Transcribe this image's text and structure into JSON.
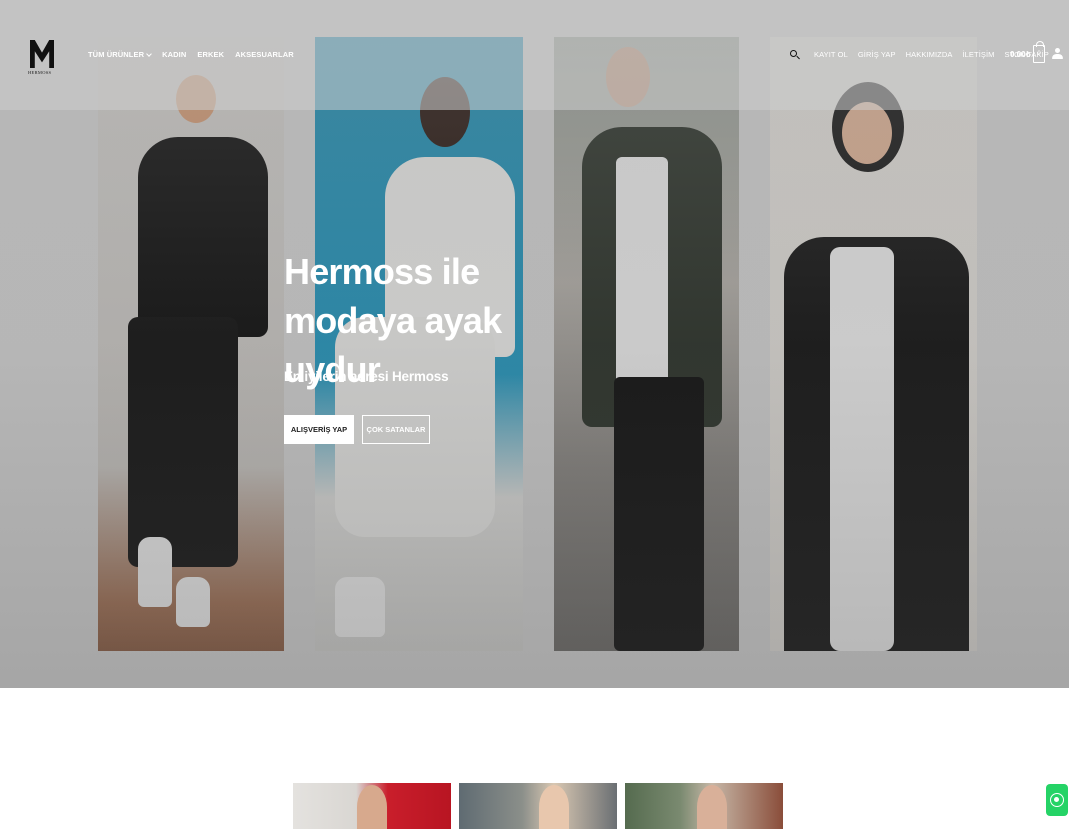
{
  "logo": {
    "text": "HERMOSS"
  },
  "nav": {
    "left": [
      {
        "label": "TÜM ÜRÜNLER",
        "has_dropdown": true
      },
      {
        "label": "KADIN"
      },
      {
        "label": "ERKEK"
      },
      {
        "label": "AKSESUARLAR"
      }
    ],
    "right": [
      {
        "label": "KAYIT OL"
      },
      {
        "label": "GİRİŞ YAP"
      },
      {
        "label": "HAKKIMIZDA"
      },
      {
        "label": "İLETİŞİM"
      },
      {
        "label": "STOK TAKİP"
      }
    ]
  },
  "cart": {
    "total": "0.00₺",
    "count": "0"
  },
  "icons": {
    "search": "search-icon",
    "cart": "shopping-bag-icon",
    "user": "user-icon",
    "whatsapp": "whatsapp-icon",
    "dropdown": "chevron-down-icon"
  },
  "hero": {
    "title": "Hermoss ile modaya ayak uydur",
    "subtitle": "En iyilerin adresi Hermoss",
    "primary_button": "ALIŞVERİŞ YAP",
    "secondary_button": "ÇOK SATANLAR"
  },
  "colors": {
    "whatsapp": "#25d366",
    "header_text": "#ffffff",
    "button_bg": "#ffffff"
  }
}
